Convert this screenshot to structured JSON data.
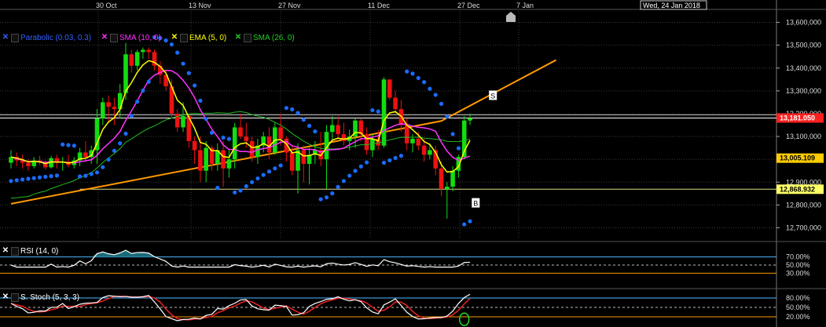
{
  "x_dates": [
    "30 Oct",
    "13 Nov",
    "27 Nov",
    "11 Dec",
    "27 Dec",
    "7 Jan"
  ],
  "cursor_date": "Wed, 24 Jan 2018",
  "price_ticks": [
    "13,600,000",
    "13,500,000",
    "13,400,000",
    "13,300,000",
    "13,200,000",
    "13,100,000",
    "13,000,000",
    "12,900,000",
    "12,800,000",
    "12,700,000"
  ],
  "price_labels": {
    "last": {
      "text": "13,181.050",
      "value": 13181.05,
      "color": "#ff2020"
    },
    "ema": {
      "text": "13,005.109",
      "value": 13005.109,
      "color": "#ffcc00"
    },
    "support": {
      "text": "12,868.932",
      "value": 12868.932,
      "color": "#ffff66"
    }
  },
  "legend": [
    {
      "label": "Parabolic (0.03, 0.3)",
      "color": "#3060ff",
      "xcolor": "#3060ff"
    },
    {
      "label": "SMA (10, 0)",
      "color": "#ff33ff",
      "xcolor": "#ff33ff"
    },
    {
      "label": "EMA (5, 0)",
      "color": "#ffff00",
      "xcolor": "#ffff00"
    },
    {
      "label": "SMA (26, 0)",
      "color": "#22cc22",
      "xcolor": "#22cc22"
    }
  ],
  "markers": {
    "sell": "S",
    "buy": "B"
  },
  "rsi": {
    "label": "RSI (14, 0)",
    "ticks": [
      "70.00%",
      "50.00%",
      "30.00%"
    ]
  },
  "stoch": {
    "label": "S. Stoch (5, 3, 3)",
    "ticks": [
      "80.00%",
      "50.00%",
      "20.00%"
    ]
  },
  "colors": {
    "up": "#11dd11",
    "down": "#ee1111",
    "parabolic": "#1a6cff",
    "sma10": "#ff33ff",
    "ema5": "#ffff00",
    "sma26": "#22bb22",
    "trend": "#ff9900"
  },
  "chart_data": {
    "type": "line",
    "xlabel": "",
    "ylabel": "",
    "ylim": [
      12650,
      13650
    ],
    "candles": [
      [
        12985,
        13040,
        12960,
        13010
      ],
      [
        13010,
        13030,
        12970,
        12995
      ],
      [
        12995,
        13020,
        12960,
        12985
      ],
      [
        12985,
        13000,
        12950,
        12970
      ],
      [
        12970,
        13010,
        12960,
        12995
      ],
      [
        12995,
        13015,
        12975,
        12985
      ],
      [
        12985,
        12995,
        12955,
        12965
      ],
      [
        12965,
        13015,
        12960,
        13005
      ],
      [
        13005,
        13020,
        12960,
        12985
      ],
      [
        12985,
        13010,
        12950,
        12990
      ],
      [
        12990,
        13020,
        12965,
        12975
      ],
      [
        12975,
        13010,
        12960,
        12995
      ],
      [
        12995,
        13050,
        12970,
        13030
      ],
      [
        13030,
        13080,
        12990,
        13010
      ],
      [
        13010,
        13060,
        12980,
        13040
      ],
      [
        13040,
        13220,
        12980,
        13180
      ],
      [
        13180,
        13270,
        13150,
        13250
      ],
      [
        13250,
        13280,
        13160,
        13230
      ],
      [
        13230,
        13270,
        13150,
        13220
      ],
      [
        13220,
        13330,
        13180,
        13290
      ],
      [
        13290,
        13510,
        13260,
        13460
      ],
      [
        13460,
        13480,
        13380,
        13410
      ],
      [
        13410,
        13480,
        13390,
        13470
      ],
      [
        13470,
        13490,
        13440,
        13480
      ],
      [
        13480,
        13490,
        13440,
        13470
      ],
      [
        13470,
        13480,
        13390,
        13410
      ],
      [
        13410,
        13430,
        13330,
        13370
      ],
      [
        13370,
        13390,
        13300,
        13320
      ],
      [
        13320,
        13350,
        13180,
        13200
      ],
      [
        13200,
        13220,
        13120,
        13140
      ],
      [
        13140,
        13250,
        13120,
        13190
      ],
      [
        13190,
        13200,
        13050,
        13080
      ],
      [
        13080,
        13100,
        12980,
        13040
      ],
      [
        13040,
        13100,
        12900,
        12950
      ],
      [
        12950,
        13080,
        12900,
        13050
      ],
      [
        13050,
        13060,
        12950,
        12980
      ],
      [
        12980,
        13070,
        12950,
        13040
      ],
      [
        13040,
        13080,
        12880,
        12960
      ],
      [
        12960,
        13040,
        12920,
        13000
      ],
      [
        13000,
        13160,
        12960,
        13140
      ],
      [
        13140,
        13200,
        13090,
        13100
      ],
      [
        13100,
        13160,
        13050,
        13080
      ],
      [
        13080,
        13100,
        12990,
        13010
      ],
      [
        13010,
        13090,
        12980,
        13060
      ],
      [
        13060,
        13120,
        13030,
        13100
      ],
      [
        13100,
        13140,
        13000,
        13030
      ],
      [
        13030,
        13160,
        13020,
        13140
      ],
      [
        13140,
        13200,
        13060,
        13090
      ],
      [
        13090,
        13100,
        12990,
        13030
      ],
      [
        13030,
        13060,
        12930,
        12950
      ],
      [
        12950,
        13070,
        12850,
        13040
      ],
      [
        13040,
        13060,
        12900,
        12980
      ],
      [
        12980,
        13050,
        12890,
        13020
      ],
      [
        13020,
        13080,
        12980,
        13040
      ],
      [
        13040,
        13120,
        12970,
        13000
      ],
      [
        13000,
        13150,
        12870,
        13120
      ],
      [
        13120,
        13190,
        13080,
        13150
      ],
      [
        13150,
        13190,
        13090,
        13110
      ],
      [
        13110,
        13160,
        13060,
        13080
      ],
      [
        13080,
        13130,
        13040,
        13100
      ],
      [
        13100,
        13180,
        13050,
        13170
      ],
      [
        13170,
        13180,
        13080,
        13110
      ],
      [
        13110,
        13140,
        13020,
        13040
      ],
      [
        13040,
        13110,
        13010,
        13090
      ],
      [
        13090,
        13130,
        13040,
        13060
      ],
      [
        13060,
        13360,
        13050,
        13350
      ],
      [
        13350,
        13350,
        13260,
        13270
      ],
      [
        13270,
        13300,
        13200,
        13220
      ],
      [
        13220,
        13260,
        13120,
        13150
      ],
      [
        13150,
        13180,
        13040,
        13070
      ],
      [
        13070,
        13110,
        13030,
        13090
      ],
      [
        13090,
        13120,
        13040,
        13060
      ],
      [
        13060,
        13090,
        12990,
        13020
      ],
      [
        13020,
        13070,
        13000,
        13040
      ],
      [
        13040,
        13060,
        12930,
        12960
      ],
      [
        12960,
        12990,
        12840,
        12870
      ],
      [
        12870,
        12900,
        12740,
        12880
      ],
      [
        12880,
        12970,
        12860,
        12950
      ],
      [
        12950,
        13020,
        12920,
        13010
      ],
      [
        13010,
        13190,
        13000,
        13170
      ],
      [
        13170,
        13200,
        13150,
        13180
      ]
    ],
    "trendline": [
      [
        0,
        12805
      ],
      [
        75,
        13168
      ],
      [
        95,
        13435
      ]
    ],
    "support_line": {
      "from": 12,
      "to": 95,
      "value": 12868.932
    }
  }
}
